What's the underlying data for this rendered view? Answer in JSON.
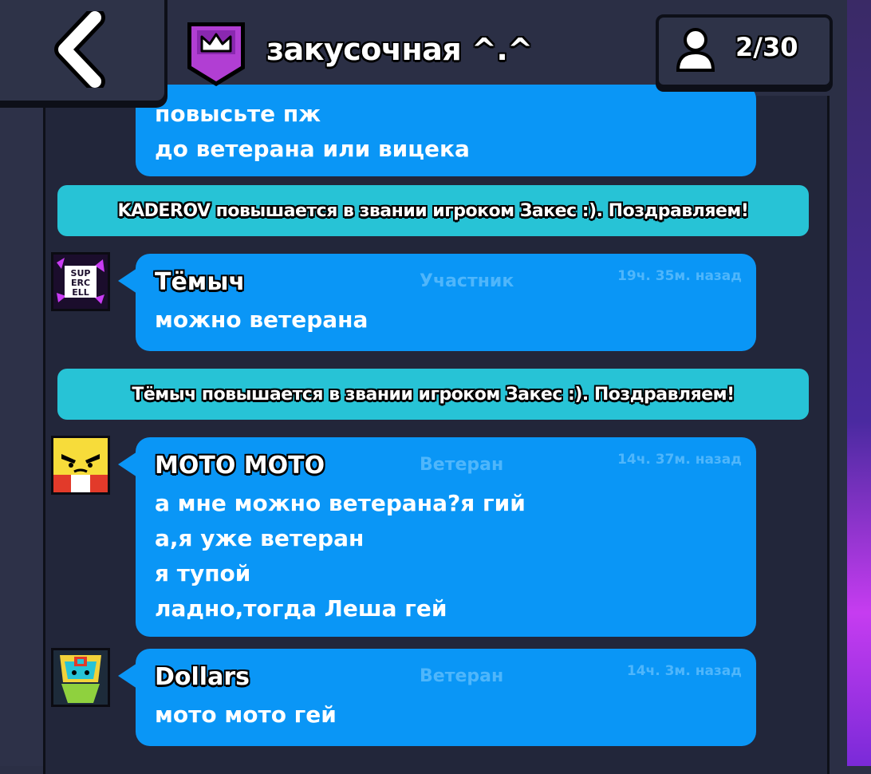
{
  "header": {
    "clan_name": "закусочная ^.^",
    "members_count": "2/30"
  },
  "messages": [
    {
      "type": "chat",
      "lines": [
        "повысьте пж",
        "до ветерана или вицека"
      ]
    },
    {
      "type": "system",
      "text": "KADEROV повышается в звании игроком Закес :). Поздравляем!"
    },
    {
      "type": "chat",
      "author": "Тёмыч",
      "role": "Участник",
      "time": "19ч. 35м. назад",
      "avatar": "supercell-logo-icon",
      "avatar_label": "SUPERCELL",
      "lines": [
        "можно ветерана"
      ]
    },
    {
      "type": "system",
      "text": "Тёмыч повышается в звании игроком Закес :). Поздравляем!"
    },
    {
      "type": "chat",
      "author": "МОТО МОТО",
      "role": "Ветеран",
      "time": "14ч. 37м. назад",
      "avatar": "angry-face-icon",
      "lines": [
        "а мне можно ветерана?я гий",
        "а,я уже ветеран",
        "я тупой",
        "ладно,тогда Леша гей"
      ]
    },
    {
      "type": "chat",
      "author": "Dollars",
      "role": "Ветеран",
      "time": "14ч. 3м. назад",
      "avatar": "brawler-portrait-icon",
      "lines": [
        "мото мото гей"
      ]
    }
  ],
  "colors": {
    "bubble": "#0a96f6",
    "system_banner": "#27c3d6",
    "panel": "#22263a",
    "badge": "#b13ed3"
  }
}
